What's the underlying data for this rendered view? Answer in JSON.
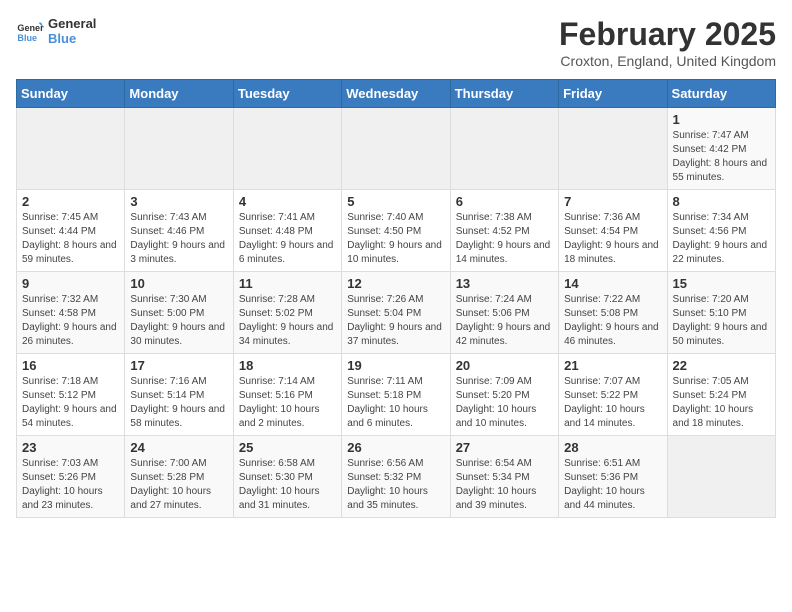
{
  "header": {
    "logo_line1": "General",
    "logo_line2": "Blue",
    "month_title": "February 2025",
    "location": "Croxton, England, United Kingdom"
  },
  "days_of_week": [
    "Sunday",
    "Monday",
    "Tuesday",
    "Wednesday",
    "Thursday",
    "Friday",
    "Saturday"
  ],
  "weeks": [
    [
      {
        "day": "",
        "info": ""
      },
      {
        "day": "",
        "info": ""
      },
      {
        "day": "",
        "info": ""
      },
      {
        "day": "",
        "info": ""
      },
      {
        "day": "",
        "info": ""
      },
      {
        "day": "",
        "info": ""
      },
      {
        "day": "1",
        "info": "Sunrise: 7:47 AM\nSunset: 4:42 PM\nDaylight: 8 hours and 55 minutes."
      }
    ],
    [
      {
        "day": "2",
        "info": "Sunrise: 7:45 AM\nSunset: 4:44 PM\nDaylight: 8 hours and 59 minutes."
      },
      {
        "day": "3",
        "info": "Sunrise: 7:43 AM\nSunset: 4:46 PM\nDaylight: 9 hours and 3 minutes."
      },
      {
        "day": "4",
        "info": "Sunrise: 7:41 AM\nSunset: 4:48 PM\nDaylight: 9 hours and 6 minutes."
      },
      {
        "day": "5",
        "info": "Sunrise: 7:40 AM\nSunset: 4:50 PM\nDaylight: 9 hours and 10 minutes."
      },
      {
        "day": "6",
        "info": "Sunrise: 7:38 AM\nSunset: 4:52 PM\nDaylight: 9 hours and 14 minutes."
      },
      {
        "day": "7",
        "info": "Sunrise: 7:36 AM\nSunset: 4:54 PM\nDaylight: 9 hours and 18 minutes."
      },
      {
        "day": "8",
        "info": "Sunrise: 7:34 AM\nSunset: 4:56 PM\nDaylight: 9 hours and 22 minutes."
      }
    ],
    [
      {
        "day": "9",
        "info": "Sunrise: 7:32 AM\nSunset: 4:58 PM\nDaylight: 9 hours and 26 minutes."
      },
      {
        "day": "10",
        "info": "Sunrise: 7:30 AM\nSunset: 5:00 PM\nDaylight: 9 hours and 30 minutes."
      },
      {
        "day": "11",
        "info": "Sunrise: 7:28 AM\nSunset: 5:02 PM\nDaylight: 9 hours and 34 minutes."
      },
      {
        "day": "12",
        "info": "Sunrise: 7:26 AM\nSunset: 5:04 PM\nDaylight: 9 hours and 37 minutes."
      },
      {
        "day": "13",
        "info": "Sunrise: 7:24 AM\nSunset: 5:06 PM\nDaylight: 9 hours and 42 minutes."
      },
      {
        "day": "14",
        "info": "Sunrise: 7:22 AM\nSunset: 5:08 PM\nDaylight: 9 hours and 46 minutes."
      },
      {
        "day": "15",
        "info": "Sunrise: 7:20 AM\nSunset: 5:10 PM\nDaylight: 9 hours and 50 minutes."
      }
    ],
    [
      {
        "day": "16",
        "info": "Sunrise: 7:18 AM\nSunset: 5:12 PM\nDaylight: 9 hours and 54 minutes."
      },
      {
        "day": "17",
        "info": "Sunrise: 7:16 AM\nSunset: 5:14 PM\nDaylight: 9 hours and 58 minutes."
      },
      {
        "day": "18",
        "info": "Sunrise: 7:14 AM\nSunset: 5:16 PM\nDaylight: 10 hours and 2 minutes."
      },
      {
        "day": "19",
        "info": "Sunrise: 7:11 AM\nSunset: 5:18 PM\nDaylight: 10 hours and 6 minutes."
      },
      {
        "day": "20",
        "info": "Sunrise: 7:09 AM\nSunset: 5:20 PM\nDaylight: 10 hours and 10 minutes."
      },
      {
        "day": "21",
        "info": "Sunrise: 7:07 AM\nSunset: 5:22 PM\nDaylight: 10 hours and 14 minutes."
      },
      {
        "day": "22",
        "info": "Sunrise: 7:05 AM\nSunset: 5:24 PM\nDaylight: 10 hours and 18 minutes."
      }
    ],
    [
      {
        "day": "23",
        "info": "Sunrise: 7:03 AM\nSunset: 5:26 PM\nDaylight: 10 hours and 23 minutes."
      },
      {
        "day": "24",
        "info": "Sunrise: 7:00 AM\nSunset: 5:28 PM\nDaylight: 10 hours and 27 minutes."
      },
      {
        "day": "25",
        "info": "Sunrise: 6:58 AM\nSunset: 5:30 PM\nDaylight: 10 hours and 31 minutes."
      },
      {
        "day": "26",
        "info": "Sunrise: 6:56 AM\nSunset: 5:32 PM\nDaylight: 10 hours and 35 minutes."
      },
      {
        "day": "27",
        "info": "Sunrise: 6:54 AM\nSunset: 5:34 PM\nDaylight: 10 hours and 39 minutes."
      },
      {
        "day": "28",
        "info": "Sunrise: 6:51 AM\nSunset: 5:36 PM\nDaylight: 10 hours and 44 minutes."
      },
      {
        "day": "",
        "info": ""
      }
    ]
  ]
}
